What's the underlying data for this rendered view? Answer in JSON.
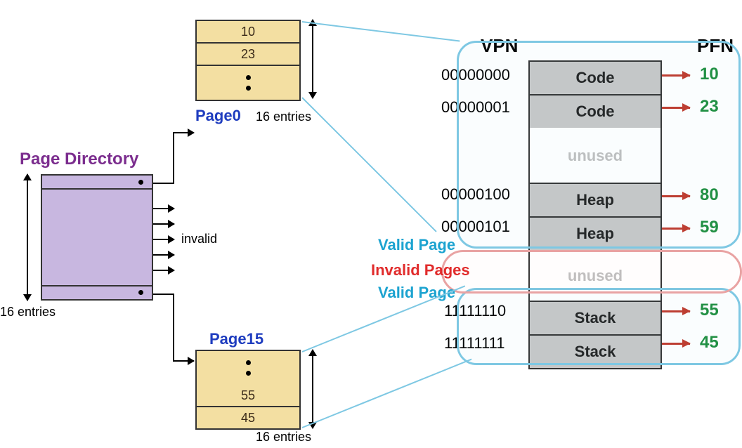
{
  "page_directory": {
    "title": "Page Directory",
    "entries_label": "16 entries",
    "invalid_label": "invalid"
  },
  "page0": {
    "title": "Page0",
    "rows": [
      "10",
      "23"
    ],
    "entries_label": "16 entries"
  },
  "page15": {
    "title": "Page15",
    "rows": [
      "55",
      "45"
    ],
    "entries_label": "16 entries"
  },
  "main": {
    "vpn_header": "VPN",
    "pfn_header": "PFN",
    "valid_label": "Valid Page",
    "invalid_label": "Invalid Pages",
    "rows": [
      {
        "vpn": "00000000",
        "label": "Code",
        "pfn": "10"
      },
      {
        "vpn": "00000001",
        "label": "Code",
        "pfn": "23"
      },
      {
        "vpn": "",
        "label": "unused",
        "pfn": ""
      },
      {
        "vpn": "00000100",
        "label": "Heap",
        "pfn": "80"
      },
      {
        "vpn": "00000101",
        "label": "Heap",
        "pfn": "59"
      },
      {
        "vpn": "",
        "label": "unused",
        "pfn": ""
      },
      {
        "vpn": "11111110",
        "label": "Stack",
        "pfn": "55"
      },
      {
        "vpn": "11111111",
        "label": "Stack",
        "pfn": "45"
      }
    ]
  }
}
